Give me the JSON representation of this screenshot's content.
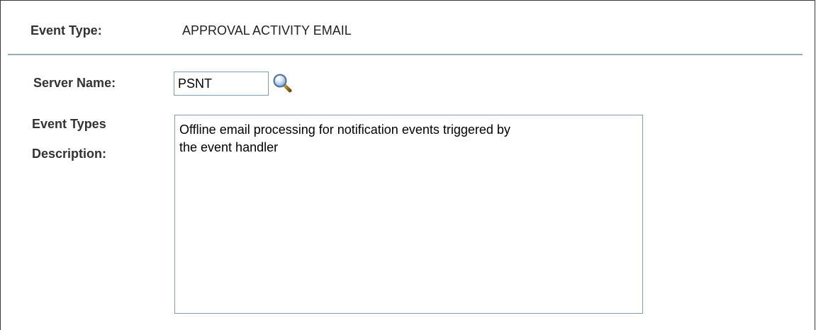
{
  "event_type": {
    "label": "Event Type:",
    "value": "APPROVAL ACTIVITY EMAIL"
  },
  "server_name": {
    "label": "Server Name:",
    "value": "PSNT",
    "lookup_icon": "magnifier-icon"
  },
  "description": {
    "label_line1": "Event Types",
    "label_line2": "Description:",
    "value": "Offline email processing for notification events triggered by\nthe event handler"
  },
  "colors": {
    "divider": "#9aabba",
    "input_border": "#7f9db9",
    "label_text": "#333333"
  }
}
